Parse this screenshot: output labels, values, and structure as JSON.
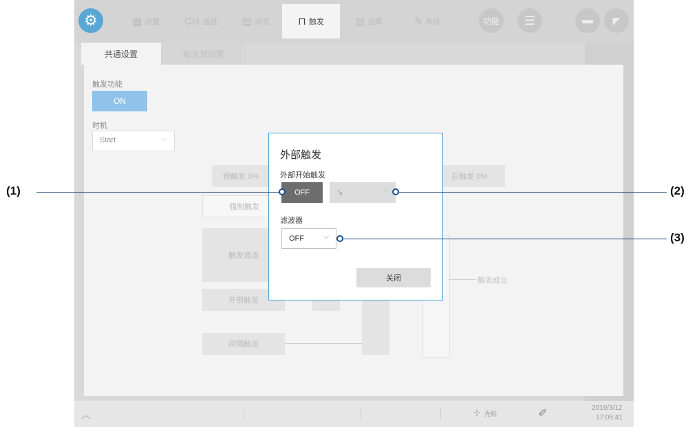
{
  "topbar": {
    "tabs": [
      {
        "label": "测量",
        "icon": "waveform-icon"
      },
      {
        "label": "通道",
        "prefix": "CH",
        "icon": "channel-icon"
      },
      {
        "label": "浏览",
        "icon": "document-icon"
      },
      {
        "label": "触发",
        "icon": "trigger-icon",
        "active": true
      },
      {
        "label": "运算",
        "icon": "grid-icon"
      },
      {
        "label": "系统",
        "icon": "wrench-icon"
      }
    ],
    "function_label": "功能"
  },
  "subtabs": [
    "共通设置",
    "触发源设置"
  ],
  "panel": {
    "trigger_function_label": "触发功能",
    "trigger_function_value": "ON",
    "timing_label": "时机",
    "timing_value": "Start",
    "pre_trigger": "预触发 0%",
    "post_trigger": "后触发 0%",
    "forced_trigger": "强制触发",
    "trigger_channel": "触发通道",
    "external_trigger": "外部触发",
    "interval_trigger": "间隔触发",
    "trigger_established": "触发成立"
  },
  "dialog": {
    "title": "外部触发",
    "ext_start_label": "外部开始触发",
    "ext_start_value": "OFF",
    "slope_value": "↘",
    "filter_label": "滤波器",
    "filter_value": "OFF",
    "close_button": "关闭"
  },
  "statusbar": {
    "cursor_label": "光标",
    "date": "2019/3/12",
    "time": "17:05:41"
  },
  "callouts": [
    "(1)",
    "(2)",
    "(3)"
  ],
  "colors": {
    "accent": "#4a9fd6",
    "gear": "#5aa7d6",
    "callout_line": "#1a3f73"
  }
}
